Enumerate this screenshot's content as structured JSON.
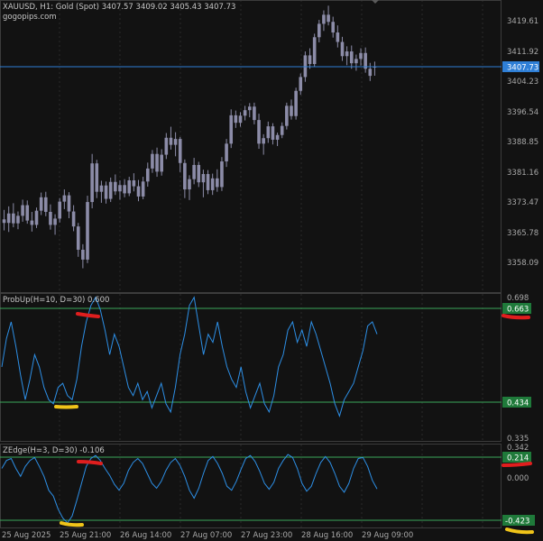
{
  "window": {
    "symbol_line": "XAUUSD, H1:  Gold (Spot)  3407.57 3409.02 3405.43 3407.73",
    "watermark": "gogopips.com"
  },
  "panes": {
    "price": {
      "y_ticks": [
        "3419.61",
        "3411.92",
        "3404.23",
        "3396.54",
        "3388.85",
        "3381.16",
        "3373.47",
        "3365.78",
        "3358.09"
      ],
      "current_price_tag": "3407.73"
    },
    "probup": {
      "header": "ProbUp(H=10, D=30) 0.600",
      "y_top": "0.698",
      "y_bottom": "0.335",
      "upper_level_tag": "0.663",
      "lower_level_tag": "0.434"
    },
    "zedge": {
      "header": "ZEdge(H=3, D=30) -0.106",
      "y_top": "0.342",
      "y_mid": "0.000",
      "upper_level_tag": "0.214",
      "lower_level_tag": "-0.423"
    }
  },
  "time_axis": [
    "25 Aug 2025",
    "25 Aug 21:00",
    "26 Aug 14:00",
    "27 Aug 07:00",
    "27 Aug 23:00",
    "28 Aug 16:00",
    "29 Aug 09:00"
  ],
  "colors": {
    "background": "#121212",
    "grid": "#2a2a2a",
    "candle": "#8c8ca8",
    "current_price_line": "#2f7fd6",
    "indicator_line": "#2d8fe6",
    "level_line": "#3aa65a",
    "level_tag_bg": "#1f7a3a",
    "price_tag_bg": "#2f7fd6",
    "mark_red": "#e01e1e",
    "mark_yellow": "#f0c419"
  },
  "chart_data": [
    {
      "type": "candlestick",
      "title": "XAUUSD, H1: Gold (Spot)",
      "ohlc_last": {
        "open": 3407.57,
        "high": 3409.02,
        "low": 3405.43,
        "close": 3407.73
      },
      "ylim": [
        3355.5,
        3425.5
      ],
      "y_ticks": [
        3419.61,
        3411.92,
        3404.23,
        3396.54,
        3388.85,
        3381.16,
        3373.47,
        3365.78,
        3358.09
      ],
      "current_price": 3407.73,
      "candles": [
        {
          "o": 3369.0,
          "h": 3371.4,
          "l": 3366.2,
          "c": 3368.1
        },
        {
          "o": 3368.1,
          "h": 3372.3,
          "l": 3365.8,
          "c": 3370.5
        },
        {
          "o": 3370.5,
          "h": 3373.1,
          "l": 3367.0,
          "c": 3368.0
        },
        {
          "o": 3368.0,
          "h": 3371.0,
          "l": 3366.5,
          "c": 3369.9
        },
        {
          "o": 3369.9,
          "h": 3374.0,
          "l": 3368.4,
          "c": 3372.6
        },
        {
          "o": 3372.6,
          "h": 3373.8,
          "l": 3367.9,
          "c": 3368.7
        },
        {
          "o": 3368.7,
          "h": 3370.9,
          "l": 3365.9,
          "c": 3367.6
        },
        {
          "o": 3367.6,
          "h": 3372.0,
          "l": 3366.8,
          "c": 3371.2
        },
        {
          "o": 3371.2,
          "h": 3375.8,
          "l": 3370.1,
          "c": 3374.6
        },
        {
          "o": 3374.6,
          "h": 3376.0,
          "l": 3369.8,
          "c": 3370.9
        },
        {
          "o": 3370.9,
          "h": 3372.8,
          "l": 3366.4,
          "c": 3367.6
        },
        {
          "o": 3367.6,
          "h": 3370.3,
          "l": 3365.1,
          "c": 3369.2
        },
        {
          "o": 3369.2,
          "h": 3374.4,
          "l": 3368.2,
          "c": 3373.5
        },
        {
          "o": 3373.5,
          "h": 3376.6,
          "l": 3371.6,
          "c": 3375.1
        },
        {
          "o": 3375.1,
          "h": 3375.9,
          "l": 3369.3,
          "c": 3371.0
        },
        {
          "o": 3371.0,
          "h": 3372.6,
          "l": 3366.0,
          "c": 3367.2
        },
        {
          "o": 3367.2,
          "h": 3368.1,
          "l": 3359.5,
          "c": 3361.3
        },
        {
          "o": 3361.3,
          "h": 3362.7,
          "l": 3356.6,
          "c": 3358.8
        },
        {
          "o": 3358.8,
          "h": 3375.0,
          "l": 3357.9,
          "c": 3373.4
        },
        {
          "o": 3373.4,
          "h": 3385.6,
          "l": 3371.8,
          "c": 3383.2
        },
        {
          "o": 3383.2,
          "h": 3384.1,
          "l": 3374.4,
          "c": 3376.0
        },
        {
          "o": 3376.0,
          "h": 3378.8,
          "l": 3373.2,
          "c": 3377.6
        },
        {
          "o": 3377.6,
          "h": 3378.6,
          "l": 3373.0,
          "c": 3374.2
        },
        {
          "o": 3374.2,
          "h": 3379.6,
          "l": 3373.4,
          "c": 3378.5
        },
        {
          "o": 3378.5,
          "h": 3380.4,
          "l": 3375.2,
          "c": 3376.1
        },
        {
          "o": 3376.1,
          "h": 3378.9,
          "l": 3374.0,
          "c": 3377.7
        },
        {
          "o": 3377.7,
          "h": 3379.2,
          "l": 3374.6,
          "c": 3375.6
        },
        {
          "o": 3375.6,
          "h": 3379.8,
          "l": 3374.9,
          "c": 3378.9
        },
        {
          "o": 3378.9,
          "h": 3380.7,
          "l": 3376.1,
          "c": 3377.4
        },
        {
          "o": 3377.4,
          "h": 3379.0,
          "l": 3373.6,
          "c": 3374.8
        },
        {
          "o": 3374.8,
          "h": 3379.8,
          "l": 3374.1,
          "c": 3378.6
        },
        {
          "o": 3378.6,
          "h": 3383.4,
          "l": 3377.3,
          "c": 3381.9
        },
        {
          "o": 3381.9,
          "h": 3386.6,
          "l": 3380.8,
          "c": 3385.6
        },
        {
          "o": 3385.6,
          "h": 3387.2,
          "l": 3379.8,
          "c": 3381.1
        },
        {
          "o": 3381.1,
          "h": 3386.8,
          "l": 3380.1,
          "c": 3385.4
        },
        {
          "o": 3385.4,
          "h": 3390.9,
          "l": 3384.3,
          "c": 3389.7
        },
        {
          "o": 3389.7,
          "h": 3392.5,
          "l": 3386.7,
          "c": 3387.9
        },
        {
          "o": 3387.9,
          "h": 3391.1,
          "l": 3385.0,
          "c": 3389.4
        },
        {
          "o": 3389.4,
          "h": 3389.9,
          "l": 3381.0,
          "c": 3383.3
        },
        {
          "o": 3383.3,
          "h": 3384.2,
          "l": 3374.4,
          "c": 3376.6
        },
        {
          "o": 3376.6,
          "h": 3380.2,
          "l": 3373.9,
          "c": 3379.2
        },
        {
          "o": 3379.2,
          "h": 3384.6,
          "l": 3377.9,
          "c": 3382.8
        },
        {
          "o": 3382.8,
          "h": 3383.6,
          "l": 3377.2,
          "c": 3378.4
        },
        {
          "o": 3378.4,
          "h": 3381.6,
          "l": 3374.6,
          "c": 3380.5
        },
        {
          "o": 3380.5,
          "h": 3381.5,
          "l": 3375.4,
          "c": 3376.4
        },
        {
          "o": 3376.4,
          "h": 3380.6,
          "l": 3375.2,
          "c": 3379.4
        },
        {
          "o": 3379.4,
          "h": 3381.7,
          "l": 3376.0,
          "c": 3377.2
        },
        {
          "o": 3377.2,
          "h": 3384.8,
          "l": 3376.2,
          "c": 3383.7
        },
        {
          "o": 3383.7,
          "h": 3389.4,
          "l": 3382.3,
          "c": 3388.2
        },
        {
          "o": 3388.2,
          "h": 3396.9,
          "l": 3387.1,
          "c": 3395.4
        },
        {
          "o": 3395.4,
          "h": 3396.6,
          "l": 3392.2,
          "c": 3393.5
        },
        {
          "o": 3393.5,
          "h": 3396.2,
          "l": 3392.5,
          "c": 3395.3
        },
        {
          "o": 3395.3,
          "h": 3397.8,
          "l": 3394.1,
          "c": 3396.7
        },
        {
          "o": 3396.7,
          "h": 3398.5,
          "l": 3394.9,
          "c": 3397.6
        },
        {
          "o": 3397.6,
          "h": 3398.6,
          "l": 3393.1,
          "c": 3394.2
        },
        {
          "o": 3394.2,
          "h": 3395.8,
          "l": 3386.9,
          "c": 3388.2
        },
        {
          "o": 3388.2,
          "h": 3390.6,
          "l": 3385.4,
          "c": 3389.6
        },
        {
          "o": 3389.6,
          "h": 3393.8,
          "l": 3388.4,
          "c": 3392.6
        },
        {
          "o": 3392.6,
          "h": 3393.4,
          "l": 3388.0,
          "c": 3389.2
        },
        {
          "o": 3389.2,
          "h": 3391.0,
          "l": 3387.6,
          "c": 3390.4
        },
        {
          "o": 3390.4,
          "h": 3393.6,
          "l": 3389.6,
          "c": 3392.7
        },
        {
          "o": 3392.7,
          "h": 3398.6,
          "l": 3391.8,
          "c": 3397.8
        },
        {
          "o": 3397.8,
          "h": 3399.4,
          "l": 3394.3,
          "c": 3395.2
        },
        {
          "o": 3395.2,
          "h": 3402.4,
          "l": 3394.3,
          "c": 3401.6
        },
        {
          "o": 3401.6,
          "h": 3406.0,
          "l": 3400.6,
          "c": 3405.1
        },
        {
          "o": 3405.1,
          "h": 3411.6,
          "l": 3403.9,
          "c": 3410.6
        },
        {
          "o": 3410.6,
          "h": 3412.4,
          "l": 3407.2,
          "c": 3408.4
        },
        {
          "o": 3408.4,
          "h": 3416.1,
          "l": 3407.6,
          "c": 3415.2
        },
        {
          "o": 3415.2,
          "h": 3419.6,
          "l": 3413.9,
          "c": 3418.6
        },
        {
          "o": 3418.6,
          "h": 3422.0,
          "l": 3416.8,
          "c": 3420.9
        },
        {
          "o": 3420.9,
          "h": 3423.2,
          "l": 3418.2,
          "c": 3419.1
        },
        {
          "o": 3419.1,
          "h": 3420.4,
          "l": 3415.1,
          "c": 3416.4
        },
        {
          "o": 3416.4,
          "h": 3418.2,
          "l": 3412.6,
          "c": 3414.0
        },
        {
          "o": 3414.0,
          "h": 3415.3,
          "l": 3409.2,
          "c": 3410.4
        },
        {
          "o": 3410.4,
          "h": 3412.9,
          "l": 3408.1,
          "c": 3411.6
        },
        {
          "o": 3411.6,
          "h": 3413.1,
          "l": 3407.2,
          "c": 3408.6
        },
        {
          "o": 3408.6,
          "h": 3410.8,
          "l": 3406.7,
          "c": 3409.7
        },
        {
          "o": 3409.7,
          "h": 3412.4,
          "l": 3408.0,
          "c": 3411.2
        },
        {
          "o": 3411.2,
          "h": 3412.6,
          "l": 3406.2,
          "c": 3407.2
        },
        {
          "o": 3407.2,
          "h": 3408.7,
          "l": 3404.1,
          "c": 3405.4
        },
        {
          "o": 3407.57,
          "h": 3409.02,
          "l": 3405.43,
          "c": 3407.73
        }
      ]
    },
    {
      "type": "line",
      "title": "ProbUp(H=10, D=30) 0.600",
      "current_value": 0.6,
      "ylim": [
        0.335,
        0.698
      ],
      "levels": [
        0.663,
        0.434
      ],
      "series": [
        {
          "values": [
            0.52,
            0.59,
            0.63,
            0.57,
            0.5,
            0.44,
            0.49,
            0.55,
            0.52,
            0.47,
            0.44,
            0.43,
            0.47,
            0.48,
            0.45,
            0.44,
            0.49,
            0.57,
            0.63,
            0.67,
            0.69,
            0.66,
            0.61,
            0.55,
            0.6,
            0.57,
            0.52,
            0.47,
            0.45,
            0.48,
            0.44,
            0.46,
            0.42,
            0.45,
            0.48,
            0.43,
            0.41,
            0.47,
            0.55,
            0.6,
            0.67,
            0.69,
            0.62,
            0.55,
            0.6,
            0.58,
            0.63,
            0.57,
            0.52,
            0.49,
            0.47,
            0.52,
            0.46,
            0.42,
            0.45,
            0.48,
            0.43,
            0.41,
            0.45,
            0.52,
            0.55,
            0.61,
            0.63,
            0.58,
            0.61,
            0.57,
            0.63,
            0.6,
            0.56,
            0.52,
            0.48,
            0.43,
            0.4,
            0.44,
            0.46,
            0.48,
            0.52,
            0.56,
            0.62,
            0.63,
            0.6
          ]
        }
      ]
    },
    {
      "type": "line",
      "title": "ZEdge(H=3, D=30) -0.106",
      "current_value": -0.106,
      "ylim": [
        -0.46,
        0.342
      ],
      "levels": [
        0.214,
        -0.423
      ],
      "series": [
        {
          "values": [
            0.1,
            0.18,
            0.2,
            0.1,
            0.02,
            0.12,
            0.18,
            0.21,
            0.12,
            0.02,
            -0.12,
            -0.18,
            -0.31,
            -0.4,
            -0.45,
            -0.38,
            -0.22,
            -0.05,
            0.12,
            0.2,
            0.23,
            0.18,
            0.1,
            0.03,
            -0.06,
            -0.12,
            -0.05,
            0.08,
            0.16,
            0.2,
            0.15,
            0.05,
            -0.05,
            -0.1,
            -0.03,
            0.08,
            0.16,
            0.2,
            0.13,
            0.02,
            -0.12,
            -0.2,
            -0.1,
            0.05,
            0.18,
            0.22,
            0.15,
            0.05,
            -0.08,
            -0.12,
            -0.03,
            0.09,
            0.2,
            0.23,
            0.17,
            0.07,
            -0.05,
            -0.11,
            -0.04,
            0.1,
            0.18,
            0.24,
            0.21,
            0.1,
            -0.05,
            -0.13,
            -0.08,
            0.05,
            0.16,
            0.22,
            0.16,
            0.05,
            -0.08,
            -0.14,
            -0.05,
            0.1,
            0.2,
            0.21,
            0.12,
            -0.02,
            -0.106
          ]
        }
      ]
    }
  ]
}
